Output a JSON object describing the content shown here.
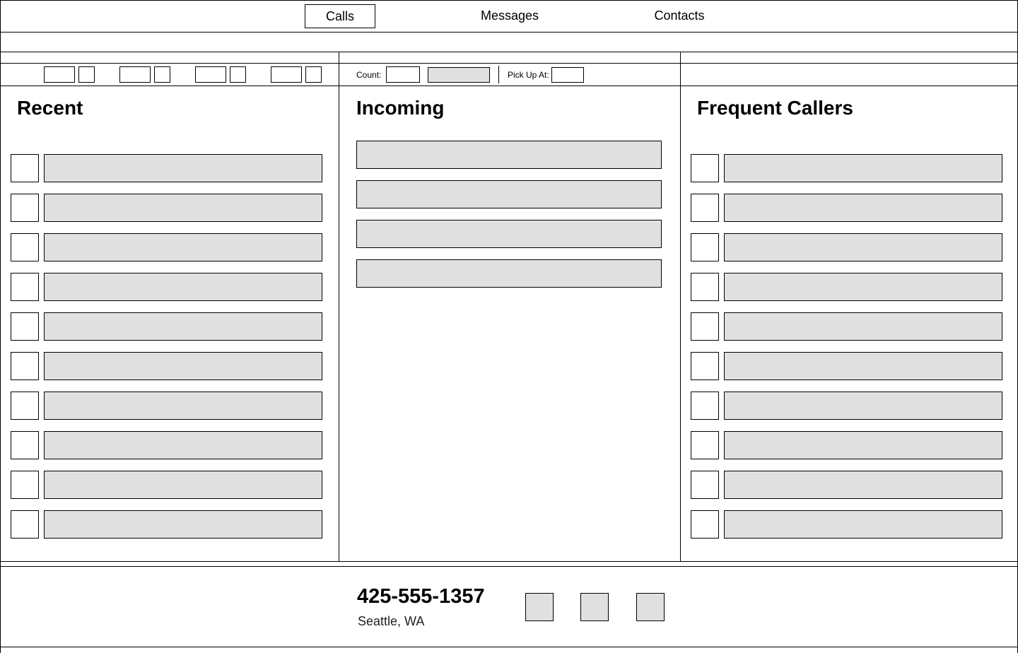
{
  "nav": {
    "tabs": [
      {
        "label": "Calls",
        "active": true
      },
      {
        "label": "Messages",
        "active": false
      },
      {
        "label": "Contacts",
        "active": false
      }
    ]
  },
  "toolbar": {
    "count_label": "Count:",
    "pickup_label": "Pick Up At:"
  },
  "columns": {
    "recent": {
      "title": "Recent",
      "row_count": 10
    },
    "incoming": {
      "title": "Incoming",
      "row_count": 4
    },
    "frequent": {
      "title": "Frequent Callers",
      "row_count": 10
    }
  },
  "caller": {
    "phone": "425-555-1357",
    "location": "Seattle, WA"
  },
  "colors": {
    "border": "#000000",
    "placeholder_fill": "#e0e0e0",
    "background": "#ffffff"
  }
}
